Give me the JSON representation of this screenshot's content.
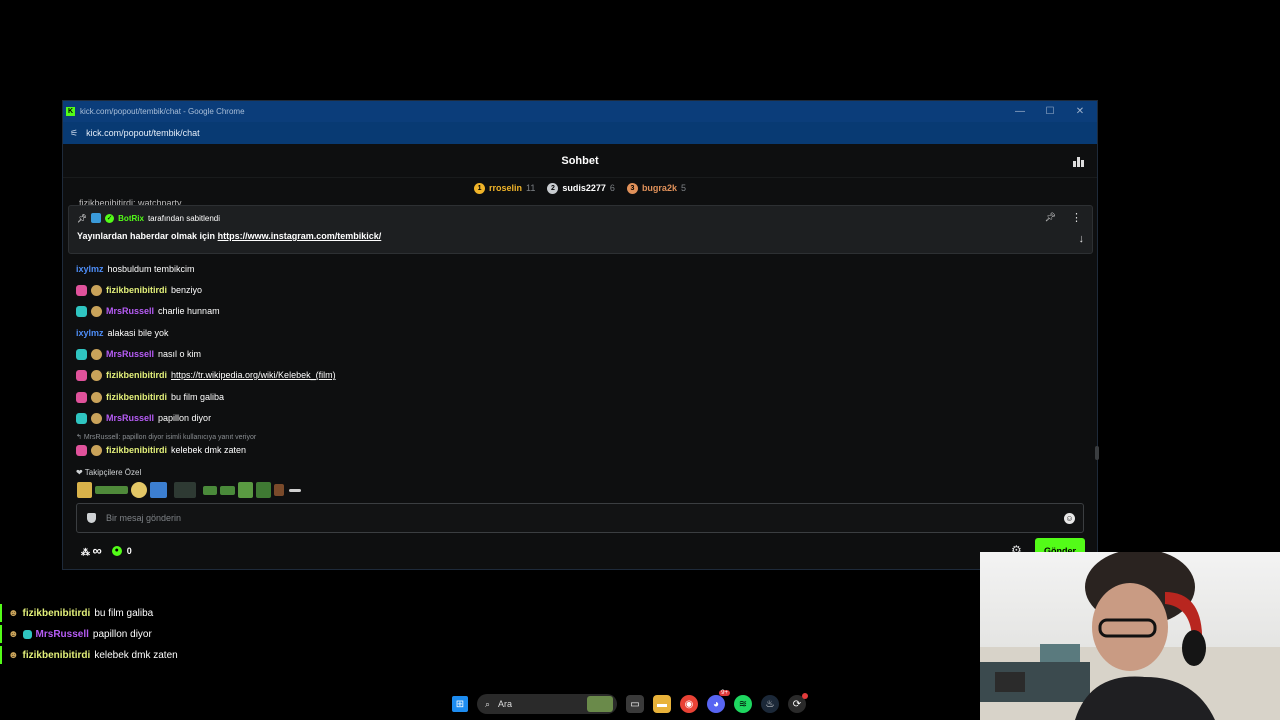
{
  "window": {
    "title": "kick.com/popout/tembik/chat - Google Chrome",
    "url": "kick.com/popout/tembik/chat",
    "brand_color": "#53fc18"
  },
  "chat": {
    "title": "Sohbet",
    "leaderboard": [
      {
        "rank": "1",
        "user": "rroselin",
        "count": "11",
        "color": "#f0b429"
      },
      {
        "rank": "2",
        "user": "sudis2277",
        "count": "6",
        "color": "#c8ccd0"
      },
      {
        "rank": "3",
        "user": "bugra2k",
        "count": "5",
        "color": "#e0915a"
      }
    ],
    "cut_message": "fizikbenibitirdi: watchparty",
    "pinned": {
      "author": "BotRix",
      "pinned_by_suffix": "tarafından sabitlendi",
      "text": "Yayınlardan haberdar olmak için",
      "link": "https://www.instagram.com/tembikick/"
    },
    "messages": [
      {
        "user": "ixylmz",
        "color": "#4d8df7",
        "text": "hosbuldum tembikcim"
      },
      {
        "user": "fizikbenibitirdi",
        "color": "#e3f07a",
        "text": "benziyo"
      },
      {
        "user": "MrsRussell",
        "color": "#b65cf5",
        "text": "charlie hunnam"
      },
      {
        "user": "ixylmz",
        "color": "#4d8df7",
        "text": "alakasi bile yok"
      },
      {
        "user": "MrsRussell",
        "color": "#b65cf5",
        "text": "nasıl o kim"
      },
      {
        "user": "fizikbenibitirdi",
        "color": "#e3f07a",
        "text": "https://tr.wikipedia.org/wiki/Kelebek_(film)"
      },
      {
        "user": "fizikbenibitirdi",
        "color": "#e3f07a",
        "text": "bu film galiba"
      },
      {
        "user": "MrsRussell",
        "color": "#b65cf5",
        "text": "papillon diyor"
      },
      {
        "user": "fizikbenibitirdi",
        "color": "#e3f07a",
        "text": "kelebek dmk zaten"
      }
    ],
    "reply_note": "MrsRussell: papillon diyor isimli kullanıcıya yanıt veriyor",
    "follower_emotes_label": "Takipçilere Özel",
    "input_placeholder": "Bir mesaj gönderin",
    "footer": {
      "infinity": "∞",
      "coins": "0"
    },
    "send_label": "Gönder"
  },
  "overlay": [
    {
      "user": "fizikbenibitirdi",
      "color": "#e3f07a",
      "text": "bu film galiba"
    },
    {
      "user": "MrsRussell",
      "color": "#b65cf5",
      "text": "papillon diyor"
    },
    {
      "user": "fizikbenibitirdi",
      "color": "#e3f07a",
      "text": "kelebek dmk zaten"
    }
  ],
  "taskbar": {
    "search_label": "Ara",
    "discord_badge": "9+"
  }
}
